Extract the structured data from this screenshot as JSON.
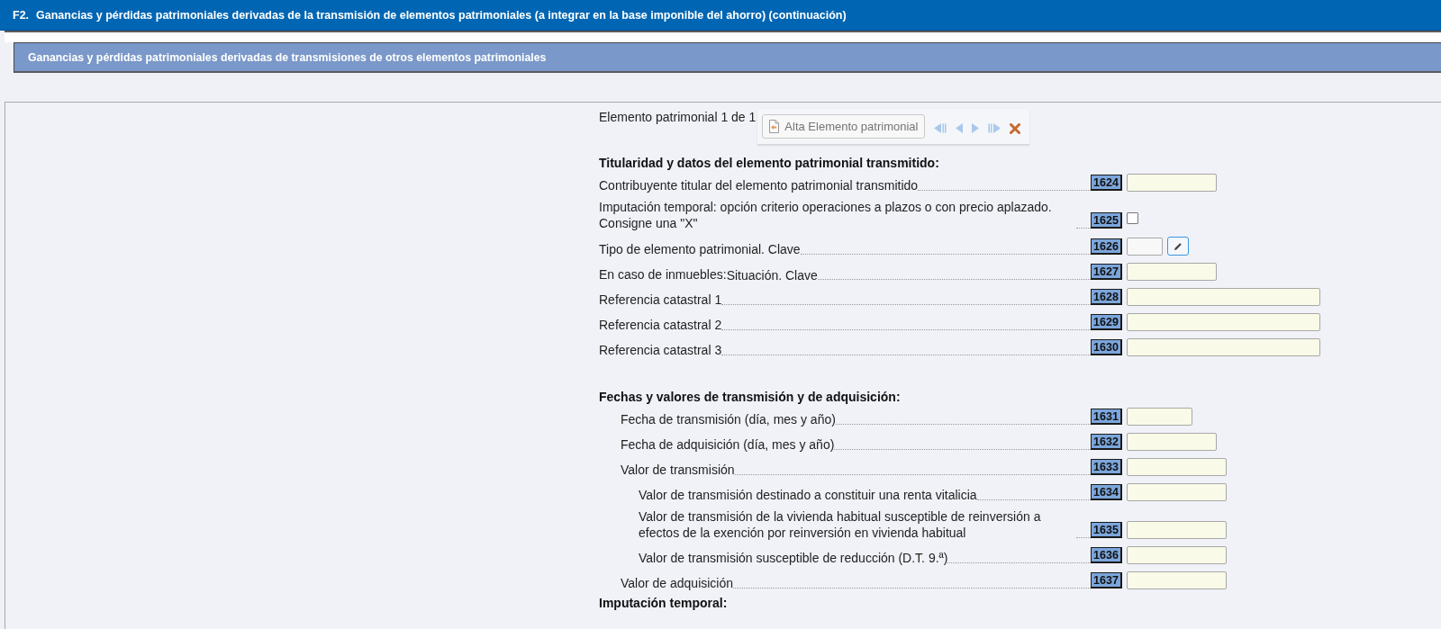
{
  "header": {
    "code": "F2.",
    "title": "Ganancias y pérdidas patrimoniales derivadas de la transmisión de elementos patrimoniales (a integrar en la base imponible del ahorro) (continuación)"
  },
  "subheader": {
    "title": "Ganancias y pérdidas patrimoniales derivadas de transmisiones de otros elementos patrimoniales"
  },
  "navigator": {
    "counter": "Elemento patrimonial 1 de 1",
    "add_button": "Alta Elemento patrimonial"
  },
  "sections": [
    {
      "heading": "Titularidad y datos del elemento patrimonial transmitido:",
      "kind": "plain",
      "rows": [
        {
          "label": "Contribuyente titular del elemento patrimonial transmitido",
          "code": "1624",
          "kind": "medium"
        },
        {
          "label": "Imputación temporal: opción criterio operaciones a plazos o con precio aplazado. Consigne una \"X\"",
          "code": "1625",
          "kind": "checkbox",
          "checked": false
        },
        {
          "label": "Tipo de elemento patrimonial. Clave",
          "code": "1626",
          "kind": "key"
        },
        {
          "label": "En caso de inmuebles:",
          "sublabel": "Situación. Clave",
          "code": "1627",
          "kind": "medium"
        },
        {
          "label": "Referencia catastral 1",
          "code": "1628",
          "kind": "long"
        },
        {
          "label": "Referencia catastral 2",
          "code": "1629",
          "kind": "long"
        },
        {
          "label": "Referencia catastral 3",
          "code": "1630",
          "kind": "long"
        }
      ]
    },
    {
      "heading": "Fechas y valores de transmisión y de adquisición:",
      "kind": "indented",
      "rows": [
        {
          "label": "Fecha de transmisión (día, mes y año)",
          "code": "1631",
          "kind": "date"
        },
        {
          "label": "Fecha de adquisición (día, mes y año)",
          "code": "1632",
          "kind": "medium"
        },
        {
          "label": "Valor de transmisión",
          "code": "1633",
          "kind": "amount",
          "children": [
            {
              "label": "Valor de transmisión destinado a constituir una renta vitalicia",
              "code": "1634",
              "kind": "amount"
            },
            {
              "label": "Valor de transmisión de la vivienda habitual susceptible de reinversión a efectos de la exención por reinversión en vivienda habitual",
              "code": "1635",
              "kind": "amount"
            },
            {
              "label": "Valor de transmisión susceptible de reducción (D.T. 9.ª)",
              "code": "1636",
              "kind": "amount"
            }
          ]
        },
        {
          "label": "Valor de adquisición",
          "code": "1637",
          "kind": "amount"
        }
      ]
    },
    {
      "heading": "Imputación temporal:"
    }
  ]
}
